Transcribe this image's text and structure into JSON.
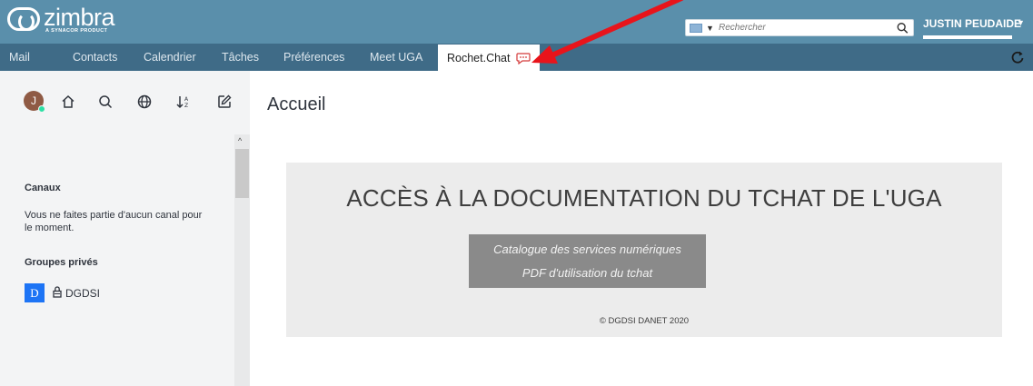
{
  "brand": {
    "name": "zimbra",
    "tagline": "A SYNACOR PRODUCT"
  },
  "search": {
    "placeholder": "Rechercher"
  },
  "user": {
    "name": "JUSTIN PEUDAIDE"
  },
  "tabs": [
    {
      "label": "Mail"
    },
    {
      "label": "Contacts"
    },
    {
      "label": "Calendrier"
    },
    {
      "label": "Tâches"
    },
    {
      "label": "Préférences"
    },
    {
      "label": "Meet UGA"
    },
    {
      "label": "Rochet.Chat"
    }
  ],
  "sidebar": {
    "avatar_initial": "J",
    "channels_heading": "Canaux",
    "channels_empty_line1": "Vous ne faites partie d'aucun canal pour",
    "channels_empty_line2": "le moment.",
    "private_heading": "Groupes privés",
    "groups": [
      {
        "initial": "D",
        "name": "DGDSI"
      }
    ]
  },
  "main": {
    "title": "Accueil",
    "doc_heading": "ACCÈS À LA DOCUMENTATION DU TCHAT DE L'UGA",
    "links": [
      {
        "label": "Catalogue des services numériques"
      },
      {
        "label": "PDF d'utilisation du tchat"
      }
    ],
    "footer": "© DGDSI DANET 2020"
  },
  "colors": {
    "topbar": "#5a8fab",
    "tabbar": "#3f6b87",
    "annotation_arrow": "#e8141b",
    "group_badge": "#1d74f5"
  },
  "icons": [
    "search-icon",
    "home-icon",
    "globe-icon",
    "sort-icon",
    "edit-icon",
    "lock-icon",
    "refresh-icon",
    "chat-icon",
    "mail-icon"
  ]
}
